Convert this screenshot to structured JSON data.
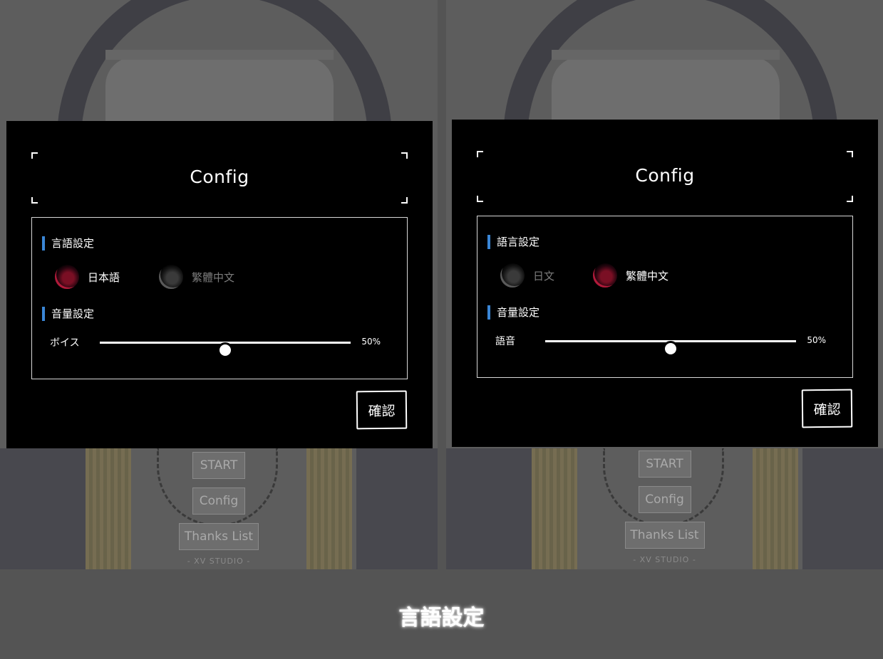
{
  "panels": [
    {
      "dialog_title": "Config",
      "language_section_title": "言語設定",
      "languages": [
        {
          "label": "日本語",
          "active": true
        },
        {
          "label": "繁體中文",
          "active": false
        }
      ],
      "volume_section_title": "音量設定",
      "volume_label": "ボイス",
      "volume_value": 50,
      "volume_value_text": "50%",
      "confirm_label": "確認",
      "menu": {
        "start": "START",
        "config": "Config",
        "thanks": "Thanks List"
      },
      "studio_logo": "- XV STUDIO -"
    },
    {
      "dialog_title": "Config",
      "language_section_title": "語言設定",
      "languages": [
        {
          "label": "日文",
          "active": false
        },
        {
          "label": "繁體中文",
          "active": true
        }
      ],
      "volume_section_title": "音量設定",
      "volume_label": "語音",
      "volume_value": 50,
      "volume_value_text": "50%",
      "confirm_label": "確認",
      "menu": {
        "start": "START",
        "config": "Config",
        "thanks": "Thanks List"
      },
      "studio_logo": "- XV STUDIO -"
    }
  ],
  "caption": "言語設定",
  "colors": {
    "accent": "#3a86d6",
    "active_language_icon": "#b01a3a",
    "background": "#545454"
  }
}
